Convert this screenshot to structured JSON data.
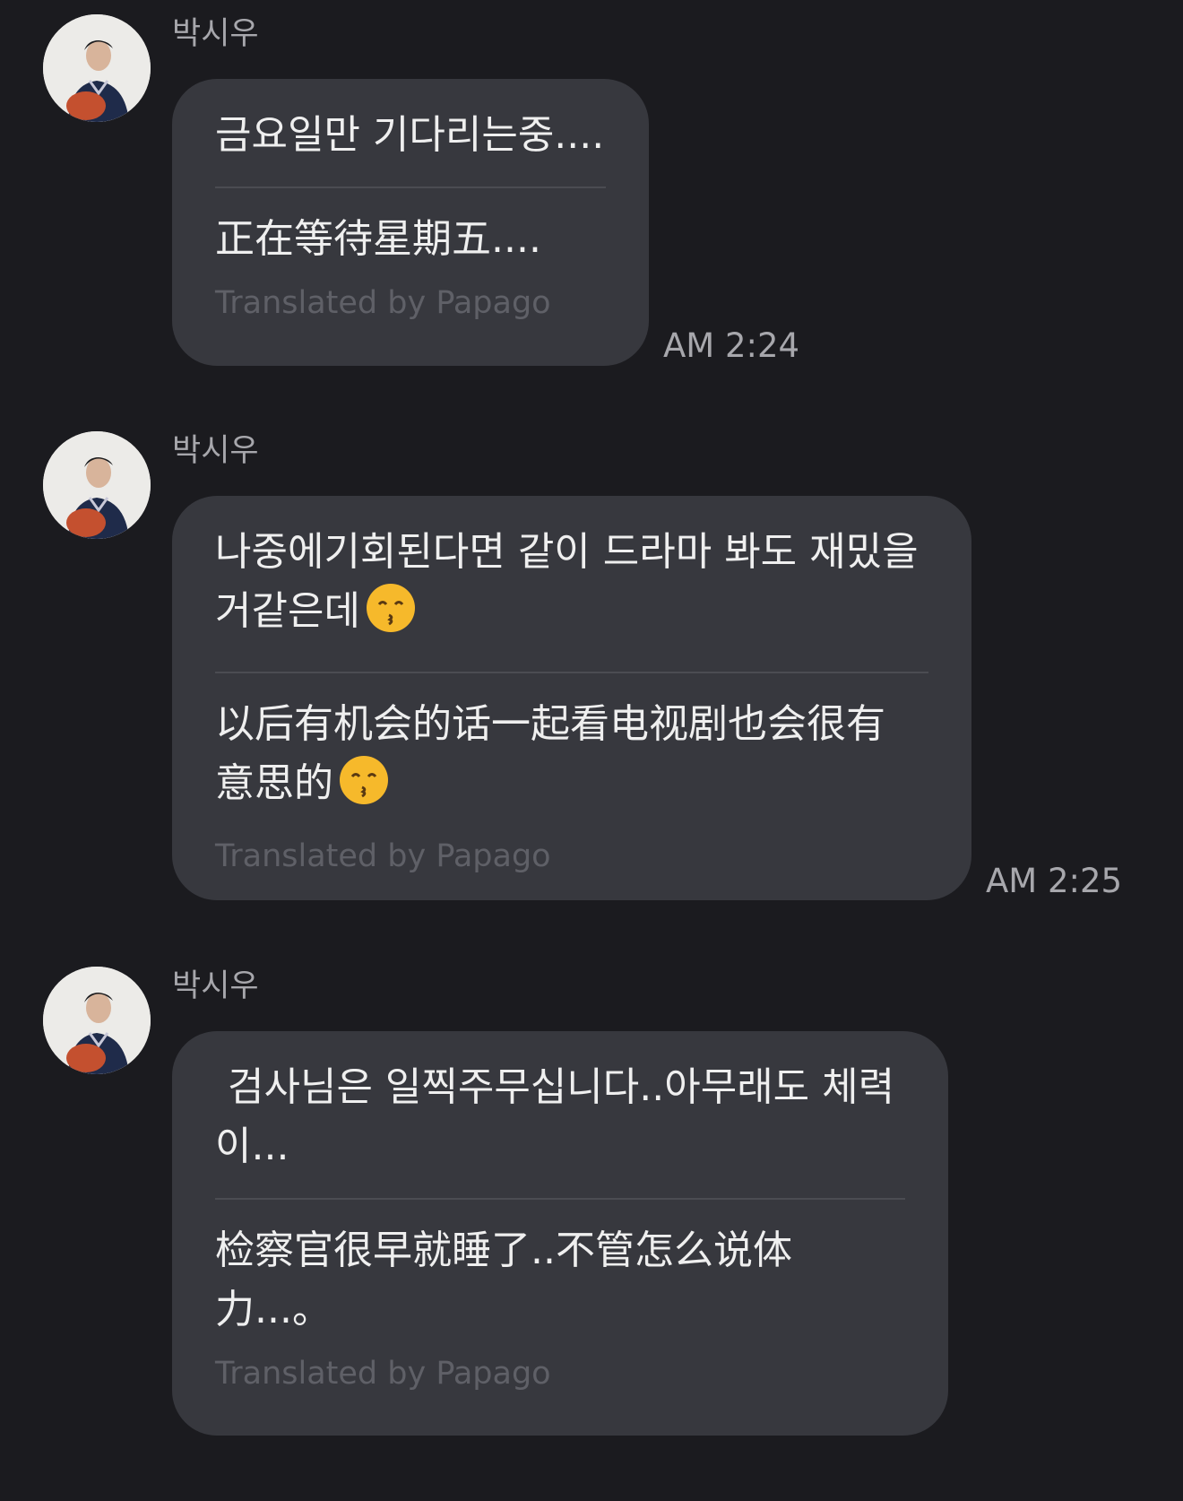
{
  "messages": [
    {
      "sender": "박시우",
      "original": "금요일만 기다리는중....",
      "translation": "正在等待星期五....",
      "translated_by": "Translated by Papago",
      "time": "AM 2:24"
    },
    {
      "sender": "박시우",
      "original": "나중에기회된다면 같이 드라마 봐도 재밌을 거같은데",
      "translation": "以后有机会的话一起看电视剧也会很有意思的",
      "emoji": "kissing-smiling-eyes-emoji",
      "translated_by": "Translated by Papago",
      "time": "AM 2:25"
    },
    {
      "sender": "박시우",
      "original": " 검사님은 일찍주무십니다..아무래도 체력이...",
      "translation": "检察官很早就睡了..不管怎么说体力...。",
      "translated_by": "Translated by Papago"
    }
  ],
  "colors": {
    "background": "#1b1b1f",
    "bubble": "#37383e",
    "text": "#efefef",
    "muted": "#a7a7ac",
    "papago": "#5f6067",
    "emoji": "#f6b92b"
  }
}
